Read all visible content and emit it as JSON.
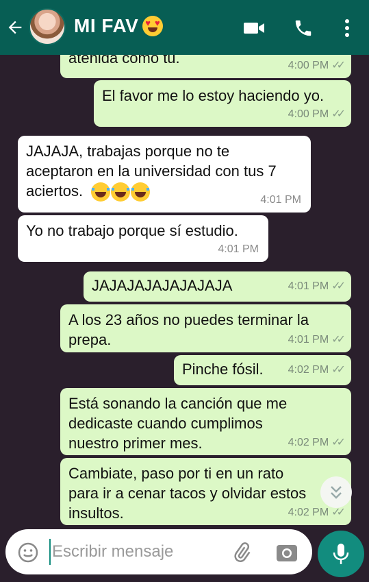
{
  "header": {
    "contact_name": "MI FAV",
    "icons": [
      "back-arrow-icon",
      "avatar",
      "heart-eyes-emoji-icon",
      "video-call-icon",
      "phone-icon",
      "more-vert-icon"
    ],
    "colors": {
      "bar": "#075e54"
    }
  },
  "messages": [
    {
      "dir": "out",
      "text": "atenida como tu.",
      "time": "4:00 PM",
      "status": "double-tick"
    },
    {
      "dir": "out",
      "text": "El favor me lo estoy haciendo yo.",
      "time": "4:00 PM",
      "status": "double-tick"
    },
    {
      "dir": "in",
      "text_lines": [
        "JAJAJA, trabajas porque no te",
        "aceptaron en la universidad con tus 7",
        "aciertos."
      ],
      "emoji": "three-laughing-emoji",
      "time": "4:01 PM"
    },
    {
      "dir": "in",
      "text": "Yo no trabajo porque sí  estudio.",
      "time": "4:01 PM"
    },
    {
      "dir": "out",
      "text": "JAJAJAJAJAJAJAJA",
      "time": "4:01 PM",
      "status": "double-tick"
    },
    {
      "dir": "out",
      "text_lines": [
        "A los 23 años no puedes terminar la",
        "prepa."
      ],
      "time": "4:01 PM",
      "status": "double-tick"
    },
    {
      "dir": "out",
      "text": "Pinche fósil.",
      "time": "4:02 PM",
      "status": "double-tick"
    },
    {
      "dir": "out",
      "text_lines": [
        "Está sonando la canción que me",
        "dedicaste cuando cumplimos",
        "nuestro primer mes."
      ],
      "time": "4:02 PM",
      "status": "double-tick"
    },
    {
      "dir": "out",
      "text_lines": [
        "Cambiate, paso por ti en un rato",
        "para ir a cenar tacos y olvidar estos",
        "insultos."
      ],
      "time": "4:02 PM",
      "status": "double-tick"
    }
  ],
  "composer": {
    "placeholder": "Escribir mensaje",
    "value": ""
  },
  "colors": {
    "outgoing_bubble": "#dcf8c6",
    "incoming_bubble": "#ffffff",
    "accent": "#128c7e",
    "chat_background": "#2a1f2c"
  }
}
